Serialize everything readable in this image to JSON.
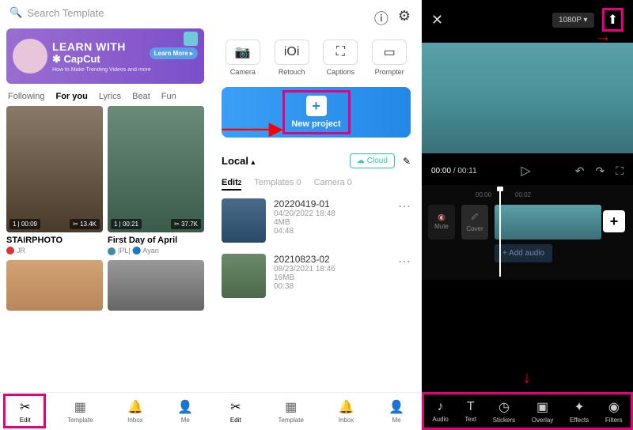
{
  "panel1": {
    "search_placeholder": "Search Template",
    "banner": {
      "title": "LEARN WITH",
      "brand": "✱ CapCut",
      "desc": "How to Make Trending Videos and more",
      "cta": "Learn More ▸"
    },
    "tabs": [
      "Following",
      "For you",
      "Lyrics",
      "Beat",
      "Fun"
    ],
    "cards": [
      {
        "title": "STAIRPHOTO",
        "user": "JR",
        "badge": "1 | 00:09",
        "stat": "✂ 13.4K"
      },
      {
        "title": "First Day of April",
        "user": "|PL| 🔵 Ayan",
        "badge": "1 | 00:21",
        "stat": "✂ 37.7K"
      }
    ],
    "nav": [
      {
        "label": "Edit",
        "icon": "scissors"
      },
      {
        "label": "Template",
        "icon": "template"
      },
      {
        "label": "Inbox",
        "icon": "bell"
      },
      {
        "label": "Me",
        "icon": "user"
      }
    ]
  },
  "panel2": {
    "tools": [
      {
        "label": "Camera",
        "icon": "📷"
      },
      {
        "label": "Retouch",
        "icon": "iOi"
      },
      {
        "label": "Captions",
        "icon": "⛶"
      },
      {
        "label": "Prompter",
        "icon": "▭"
      }
    ],
    "new_project": "New project",
    "local": "Local",
    "cloud": "Cloud",
    "proj_tabs": [
      {
        "label": "Edit",
        "count": "2"
      },
      {
        "label": "Templates",
        "count": "0"
      },
      {
        "label": "Camera",
        "count": "0"
      }
    ],
    "projects": [
      {
        "name": "20220419-01",
        "date": "04/20/2022 18:48",
        "size": "4MB",
        "dur": "04:48"
      },
      {
        "name": "20210823-02",
        "date": "08/23/2021 18:46",
        "size": "16MB",
        "dur": "00:38"
      }
    ]
  },
  "panel3": {
    "resolution": "1080P ▾",
    "time_current": "00:00",
    "time_total": "/ 00:11",
    "ruler": [
      "00:00",
      "00:02"
    ],
    "track_buttons": [
      {
        "label": "Mute",
        "icon": "🔇"
      },
      {
        "label": "Cover",
        "icon": "🖉"
      }
    ],
    "add_audio": "+ Add audio",
    "nav": [
      {
        "label": "Audio",
        "icon": "♪"
      },
      {
        "label": "Text",
        "icon": "T"
      },
      {
        "label": "Stickers",
        "icon": "◷"
      },
      {
        "label": "Overlay",
        "icon": "▣"
      },
      {
        "label": "Effects",
        "icon": "✦"
      },
      {
        "label": "Filters",
        "icon": "◉"
      }
    ]
  }
}
